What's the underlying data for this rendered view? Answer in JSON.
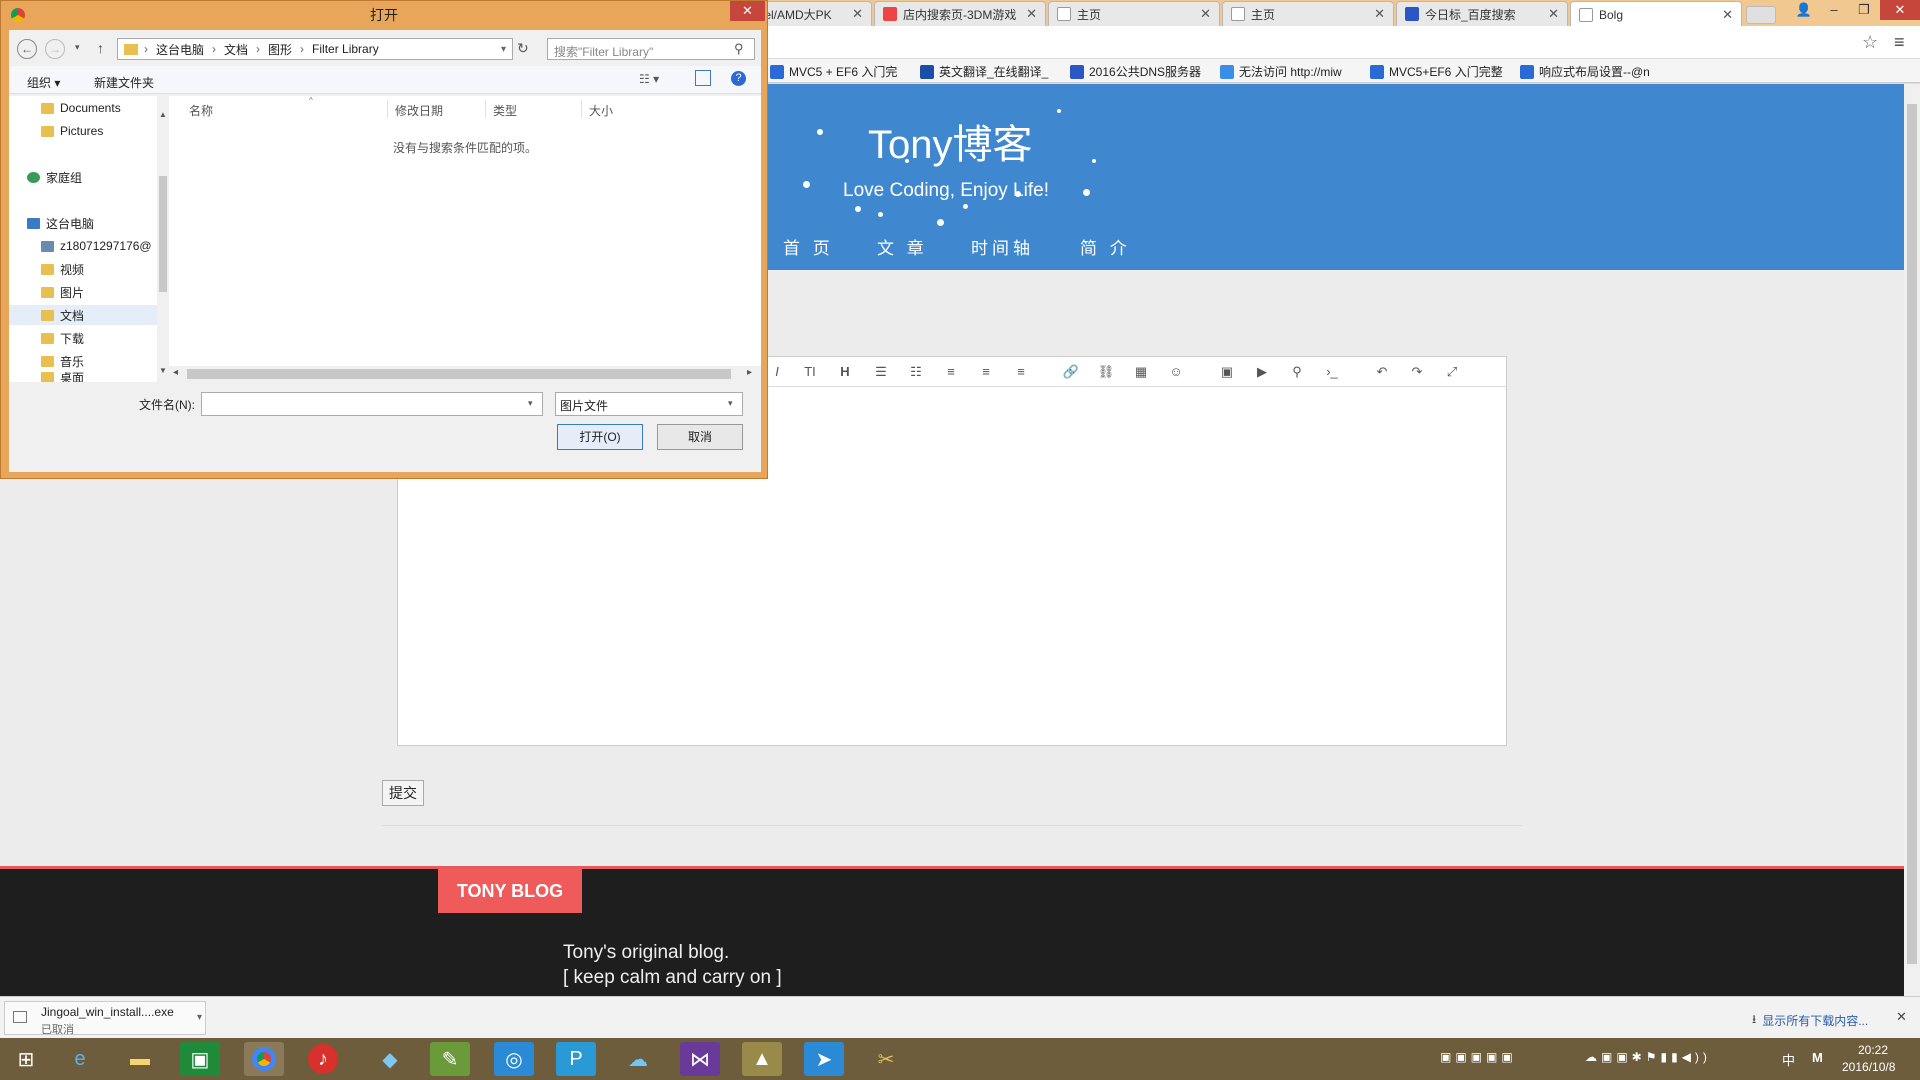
{
  "dialog": {
    "title": "打开",
    "close_label": "✕",
    "breadcrumb": [
      "这台电脑",
      "文档",
      "图形",
      "Filter Library"
    ],
    "search_placeholder": "搜索\"Filter Library\"",
    "organize_label": "组织 ▾",
    "new_folder_label": "新建文件夹",
    "nav_items": [
      {
        "label": "Documents"
      },
      {
        "label": "Pictures"
      },
      {
        "label": "家庭组"
      },
      {
        "label": "这台电脑"
      },
      {
        "label": "z18071297176@"
      },
      {
        "label": "视频"
      },
      {
        "label": "图片"
      },
      {
        "label": "文档"
      },
      {
        "label": "下载"
      },
      {
        "label": "音乐"
      },
      {
        "label": "桌面"
      }
    ],
    "columns": [
      "名称",
      "修改日期",
      "类型",
      "大小"
    ],
    "empty_message": "没有与搜索条件匹配的项。",
    "filename_label": "文件名(N):",
    "filename_value": "",
    "filetype_value": "图片文件",
    "open_label": "打开(O)",
    "cancel_label": "取消"
  },
  "browser": {
    "tabs": [
      {
        "label": "tel/AMD大PK"
      },
      {
        "label": "店内搜索页-3DM游戏"
      },
      {
        "label": "主页"
      },
      {
        "label": "主页"
      },
      {
        "label": "今日标_百度搜索"
      },
      {
        "label": "Bolg"
      }
    ],
    "bookmarks": [
      {
        "label": "MVC5 + EF6 入门完"
      },
      {
        "label": "英文翻译_在线翻译_"
      },
      {
        "label": "2016公共DNS服务器"
      },
      {
        "label": "无法访问 http://miw"
      },
      {
        "label": "MVC5+EF6 入门完整"
      },
      {
        "label": "响应式布局设置--@n"
      }
    ]
  },
  "blog": {
    "title": "Tony博客",
    "subtitle": "Love Coding, Enjoy Life!",
    "nav": [
      "首 页",
      "文 章",
      "时间轴",
      "简 介"
    ],
    "submit_label": "提交",
    "footer_badge": "TONY BLOG",
    "footer_line1": "Tony's original blog.",
    "footer_line2": "[ keep calm and carry on ]"
  },
  "downloads": {
    "file_name": "Jingoal_win_install....exe",
    "file_status": "已取消",
    "show_all": "显示所有下载内容..."
  },
  "taskbar": {
    "time": "20:22",
    "date": "2016/10/8",
    "ime": "中"
  },
  "colors": {
    "banner": "#3f88cf",
    "footer_accent": "#ef5b5b",
    "dialog_frame": "#e8a65a"
  }
}
